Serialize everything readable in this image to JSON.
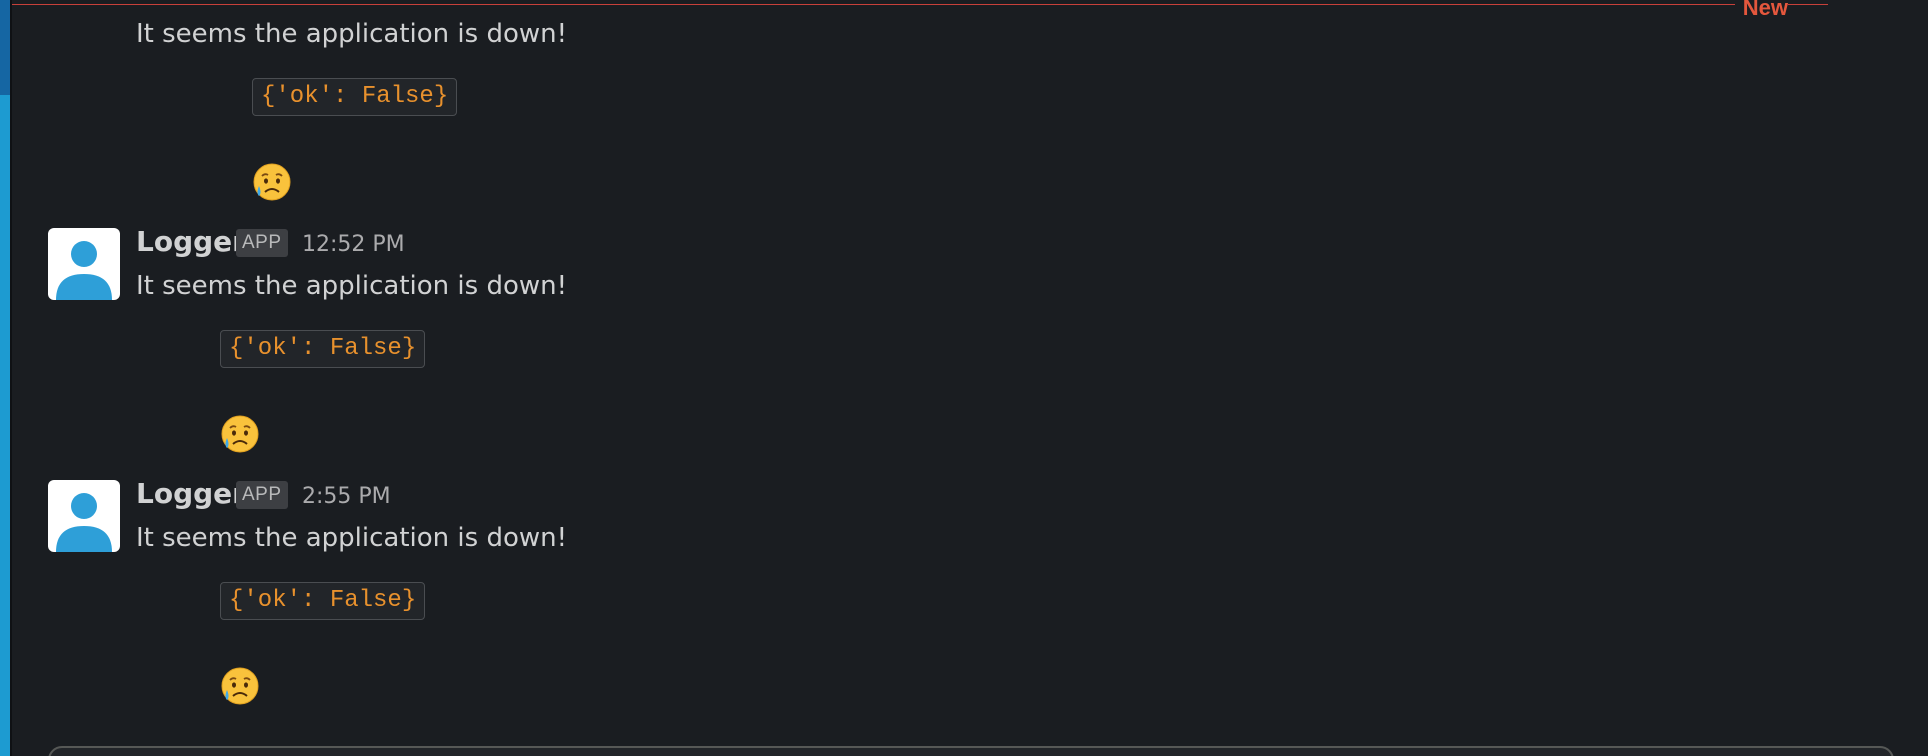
{
  "divider": {
    "label": "New"
  },
  "messages": [
    {
      "sender": "",
      "badge": "",
      "time": "",
      "text": "It seems the application is down!",
      "code": "{'ok': False}",
      "emoji": "sad-but-relieved-face-icon"
    },
    {
      "sender": "Logger",
      "badge": "APP",
      "time": "12:52 PM",
      "text": "It seems the application is down!",
      "code": "{'ok': False}",
      "emoji": "sad-but-relieved-face-icon"
    },
    {
      "sender": "Logger",
      "badge": "APP",
      "time": "2:55 PM",
      "text": "It seems the application is down!",
      "code": "{'ok': False}",
      "emoji": "sad-but-relieved-face-icon"
    }
  ],
  "colors": {
    "background": "#1a1d21",
    "text": "#d1d2d3",
    "code_text": "#e8912d",
    "new_divider": "#e4573d",
    "rail": "#1d9bd1",
    "avatar_icon": "#2e9fd8"
  }
}
